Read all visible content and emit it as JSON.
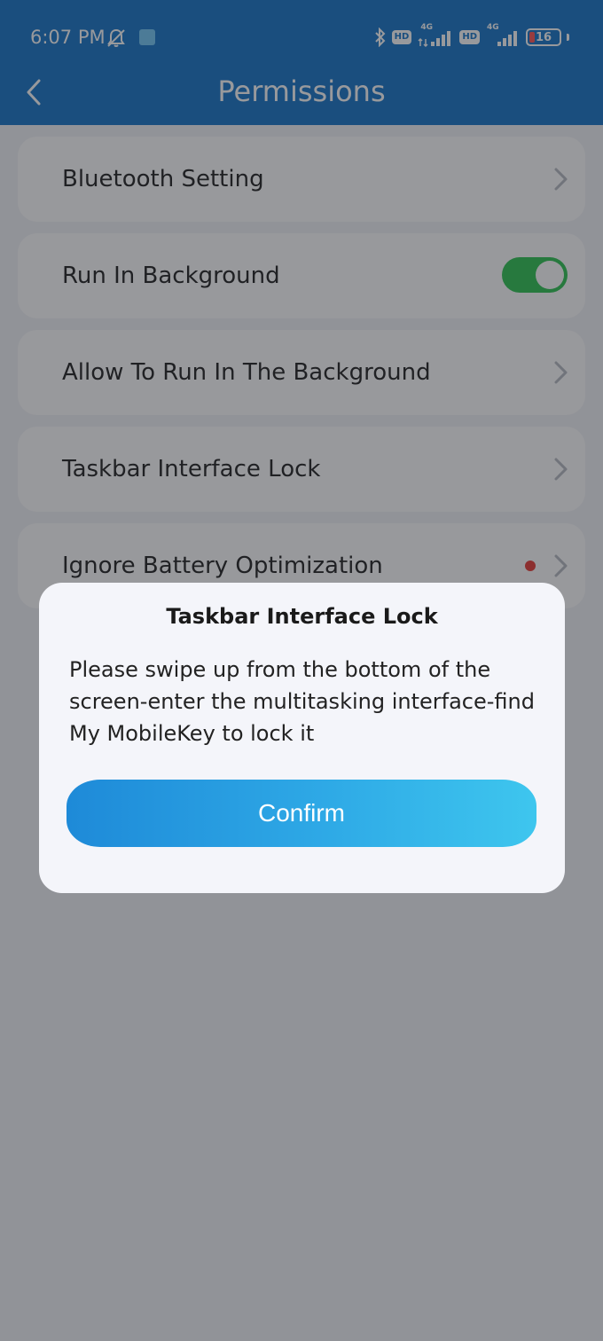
{
  "status_bar": {
    "time": "6:07 PM",
    "network_1": "4G",
    "network_2": "4G",
    "hd_label": "HD",
    "battery_level": "16"
  },
  "header": {
    "title": "Permissions"
  },
  "settings": {
    "items": [
      {
        "label": "Bluetooth Setting",
        "control": "chevron"
      },
      {
        "label": "Run In Background",
        "control": "toggle",
        "enabled": true
      },
      {
        "label": "Allow To Run In The Background",
        "control": "chevron"
      },
      {
        "label": "Taskbar Interface Lock",
        "control": "chevron"
      },
      {
        "label": "Ignore Battery Optimization",
        "control": "chevron",
        "alert": true
      }
    ]
  },
  "dialog": {
    "title": "Taskbar Interface Lock",
    "message": "Please swipe up from the bottom of the screen-enter the multitasking interface-find My MobileKey to lock it",
    "confirm_label": "Confirm"
  },
  "colors": {
    "header_bg": "#0f70c6",
    "toggle_on": "#27c24c",
    "alert_dot": "#e8342f",
    "button_start": "#1e8ad8",
    "button_end": "#3ec6ee"
  }
}
